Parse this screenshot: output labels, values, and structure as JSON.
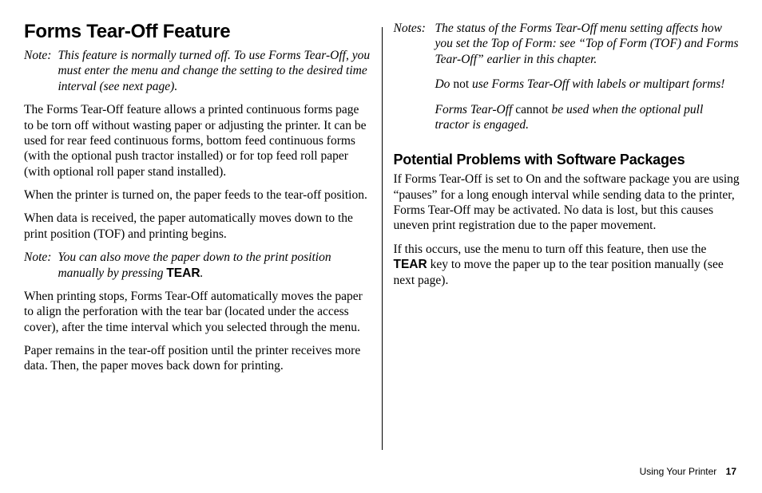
{
  "left": {
    "heading": "Forms Tear-Off Feature",
    "note1_label": "Note:",
    "note1_body": "This feature is normally turned off. To use Forms Tear-Off, you must enter the menu and change the setting to the desired time interval (see next page).",
    "p1": "The Forms Tear-Off feature allows a printed continuous forms page to be torn off without wasting paper or adjusting the printer. It can be used for rear feed continuous forms, bottom feed continuous forms (with the optional push tractor installed) or for top feed roll paper (with optional roll paper stand installed).",
    "p2": "When the printer is turned on, the paper feeds to the tear-off position.",
    "p3": "When data is received, the paper automatically moves down to the print position (TOF) and printing begins.",
    "note2_label": "Note:",
    "note2_body_pre": "You can also move the paper down to the print position manually by pressing ",
    "note2_body_key": "TEAR",
    "note2_body_post": ".",
    "p4": "When printing stops, Forms Tear-Off automatically moves the paper to align the perforation with the tear bar (located under the access cover), after the time interval which you selected through the menu.",
    "p5": "Paper remains in the tear-off position until the printer receives more data. Then, the paper moves back down for printing."
  },
  "right": {
    "notes_label": "Notes:",
    "note_a": "The status of the Forms Tear-Off menu setting affects how you set the Top of Form: see “Top of Form (TOF) and Forms Tear-Off” earlier in this chapter.",
    "note_b_pre": "Do ",
    "note_b_not": "not",
    "note_b_post": " use Forms Tear-Off with labels or multipart forms!",
    "note_c_pre": "Forms Tear-Off ",
    "note_c_mid": "cannot",
    "note_c_post": " be used when the optional pull tractor is engaged.",
    "h2": "Potential Problems with Software Packages",
    "p1": "If Forms Tear-Off is set to On and the software package you are using “pauses” for a long enough interval while sending data to the printer, Forms Tear-Off may be activated. No data is lost, but this causes uneven print registration due to the paper movement.",
    "p2_pre": "If this occurs, use the menu to turn off this feature, then use the ",
    "p2_key": "TEAR",
    "p2_post": " key to move the paper up to the tear position manually (see next page)."
  },
  "footer": {
    "section": "Using Your Printer",
    "page": "17"
  }
}
